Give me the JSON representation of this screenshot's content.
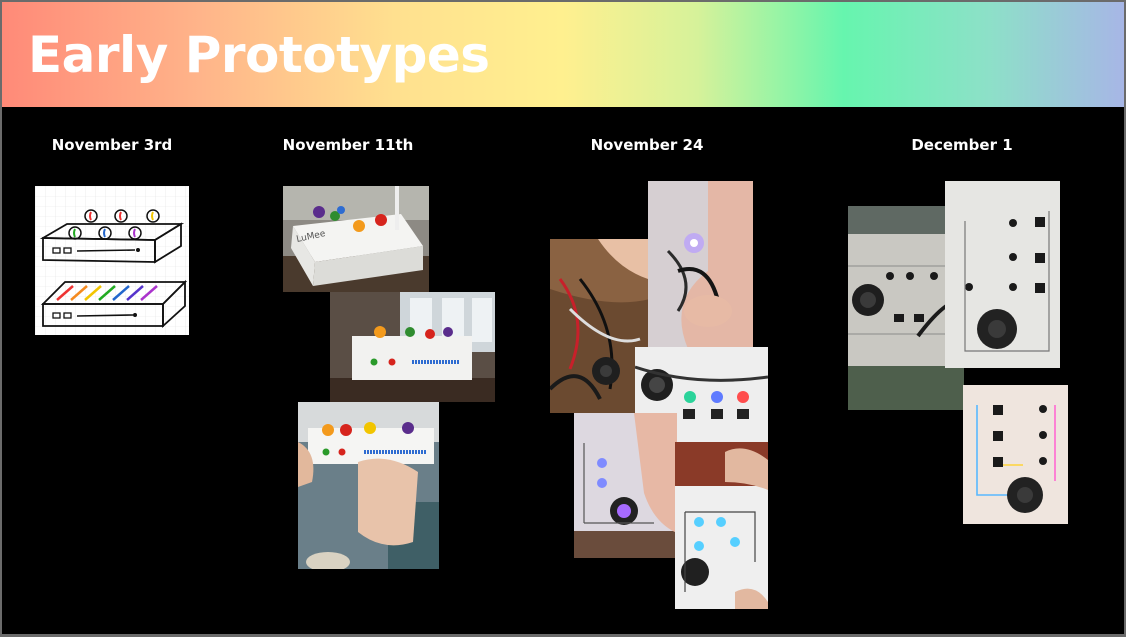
{
  "slide": {
    "title": "Early Prototypes",
    "columns": [
      {
        "date": "November 3rd"
      },
      {
        "date": "November 11th"
      },
      {
        "date": "November 24"
      },
      {
        "date": "December 1"
      }
    ],
    "sketch_label": "LuMee",
    "colors": {
      "background": "#000000",
      "banner_gradient": [
        "#ff8a78",
        "#ffe08f",
        "#66f5ae",
        "#a7b6e6"
      ],
      "title_text": "#ffffff"
    }
  }
}
